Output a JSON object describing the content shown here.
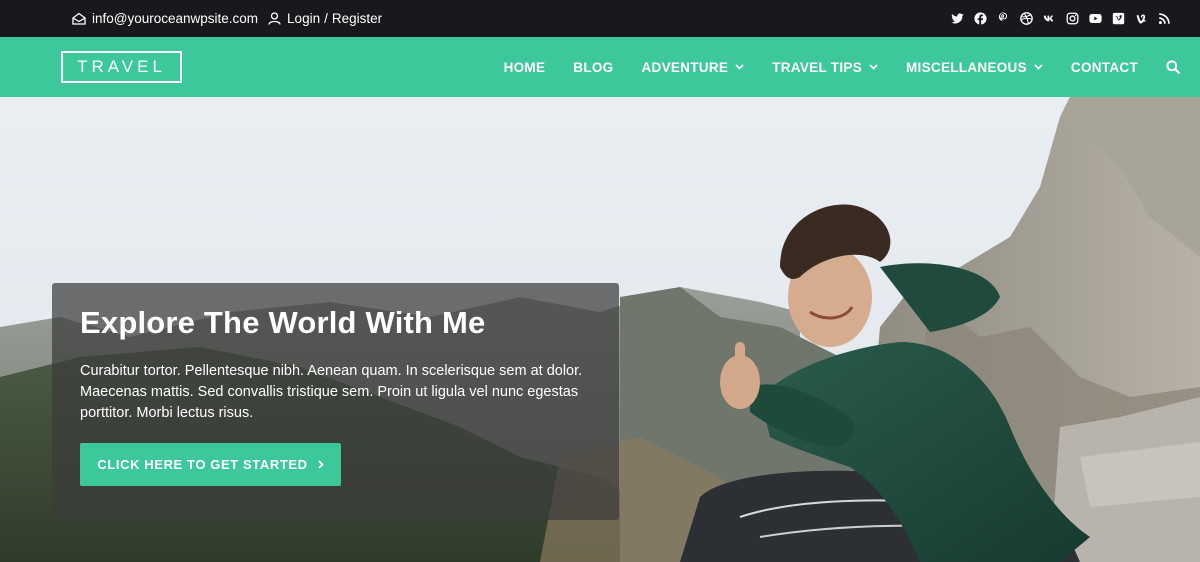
{
  "topbar": {
    "email": "info@youroceanwpsite.com",
    "login": "Login",
    "separator": "/",
    "register": "Register",
    "social_icons": [
      "twitter-icon",
      "facebook-icon",
      "pinterest-icon",
      "dribbble-icon",
      "vk-icon",
      "instagram-icon",
      "youtube-icon",
      "vimeo-square-icon",
      "vine-icon",
      "rss-icon"
    ]
  },
  "header": {
    "logo": "TRAVEL",
    "nav": [
      {
        "label": "HOME",
        "dropdown": false
      },
      {
        "label": "BLOG",
        "dropdown": false
      },
      {
        "label": "ADVENTURE",
        "dropdown": true
      },
      {
        "label": "TRAVEL TIPS",
        "dropdown": true
      },
      {
        "label": "MISCELLANEOUS",
        "dropdown": true
      },
      {
        "label": "CONTACT",
        "dropdown": false
      }
    ],
    "search_icon": "search-icon"
  },
  "hero": {
    "title": "Explore The World With Me",
    "text": "Curabitur tortor. Pellentesque nibh. Aenean quam. In scelerisque sem at dolor. Maecenas mattis. Sed convallis tristique sem. Proin ut ligula vel nunc egestas porttitor. Morbi lectus risus.",
    "cta_label": "CLICK HERE TO GET STARTED",
    "cta_icon": "chevron-right-icon"
  },
  "colors": {
    "accent": "#3cc89a",
    "topbar_bg": "#17191c"
  }
}
